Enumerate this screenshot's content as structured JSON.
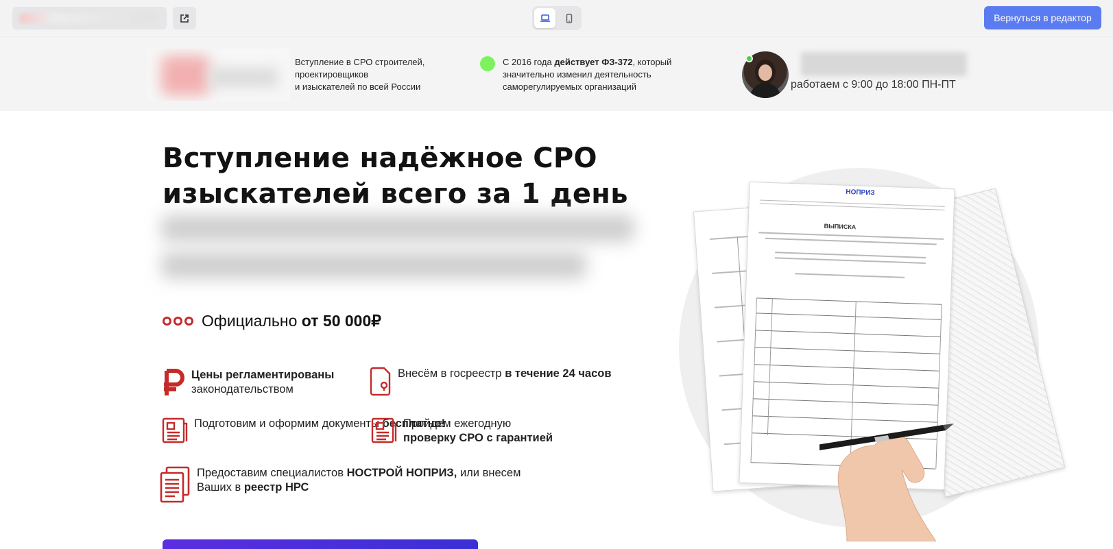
{
  "editor": {
    "back_button": "Вернуться в редактор"
  },
  "header": {
    "tagline": "Вступление в СРО строителей,\nпроектировщиков\nи изыскателей по всей России",
    "law_prefix": "С 2016 года ",
    "law_bold": "действует ФЗ-372",
    "law_suffix": ", который\nзначительно изменил деятельность\nсаморегулируемых организаций",
    "work_hours": "работаем с 9:00 до 18:00 ПН-ПТ"
  },
  "hero": {
    "title": "Вступление надёжное СРО изыскателей всего за 1 день",
    "price_prefix": "Официально ",
    "price_bold": "от 50 000₽"
  },
  "features": [
    {
      "icon": "ruble-icon",
      "bold": "Цены регламентированы",
      "text": "законодательством"
    },
    {
      "icon": "document-stamp-icon",
      "text": "Внесём в госреестр ",
      "bold": "в течение 24 часов"
    },
    {
      "icon": "document-list-icon",
      "text": "Подготовим и оформим документы ",
      "bold": "бесплатно!"
    },
    {
      "icon": "document-list-icon",
      "text": "Пройдем ежегодную ",
      "bold": "проверку СРО с гарантией"
    },
    {
      "icon": "documents-stack-icon",
      "text_a": "Предоставим специалистов ",
      "bold_a": "НОСТРОЙ НОПРИЗ,",
      "text_b": " или внесем Ваших в ",
      "bold_b": "реестр НРС"
    }
  ],
  "illustration": {
    "badge": "НОПРИЗ",
    "doc_heading": "ВЫПИСКА"
  },
  "colors": {
    "accent_red": "#c52a2a",
    "editor_blue": "#5b7cf0",
    "online_green": "#7ef25e",
    "cta_purple": "#5b2ee0"
  }
}
